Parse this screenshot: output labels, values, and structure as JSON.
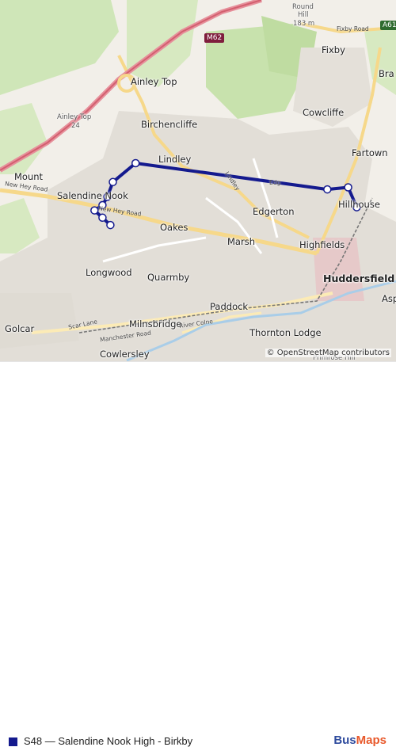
{
  "map": {
    "places": {
      "round_hill": "Round",
      "hill": "Hill",
      "hill_elev": "183 m",
      "fixby": "Fixby",
      "bra": "Bra",
      "ainley_top": "Ainley Top",
      "ainley_top_24": "Ainley Top",
      "birchencliffe": "Birchencliffe",
      "cowcliffe": "Cowcliffe",
      "fartown": "Fartown",
      "lindley": "Lindley",
      "mount": "Mount",
      "salendine_nook": "Salendine Nook",
      "hillhouse": "Hillhouse",
      "edgerton": "Edgerton",
      "oakes": "Oakes",
      "highfields": "Highfields",
      "marsh": "Marsh",
      "huddersfield": "Huddersfield",
      "longwood": "Longwood",
      "quarmby": "Quarmby",
      "asp": "Asp",
      "paddock": "Paddock",
      "golcar": "Golcar",
      "milnsbridge": "Milnsbridge",
      "thornton_lodge": "Thornton Lodge",
      "cowlersley": "Cowlersley",
      "primrose_hill": "Primrose Hill"
    },
    "roads": {
      "fixby_road": "Fixby Road",
      "new_hey_road": "New Hey Road",
      "new_hey_road_2": "New Hey Road",
      "scar_lane": "Scar Lane",
      "manchester_road": "Manchester Road",
      "river_colne": "River Colne",
      "lindley_road": "Lindley",
      "edgerton_road": "Edg"
    },
    "shields": {
      "m62": "M62",
      "a61": "A61",
      "j24": "24"
    },
    "attribution": "© OpenStreetMap contributors",
    "route": {
      "color": "#141a8e",
      "stops": [
        {
          "name": "Salendine Nook High",
          "lat": 53.6523,
          "lon": -1.8354
        },
        {
          "name": "stop-2",
          "lat": 53.6528,
          "lon": -1.8341
        },
        {
          "name": "stop-3",
          "lat": 53.6536,
          "lon": -1.8333
        },
        {
          "name": "stop-4",
          "lat": 53.655,
          "lon": -1.8324
        },
        {
          "name": "stop-5",
          "lat": 53.6568,
          "lon": -1.8287
        },
        {
          "name": "stop-6",
          "lat": 53.6543,
          "lon": -1.7974
        },
        {
          "name": "stop-7",
          "lat": 53.6545,
          "lon": -1.794
        },
        {
          "name": "Birkby",
          "lat": 53.6526,
          "lon": -1.7926
        },
        {
          "name": "stop-9",
          "lat": 53.6516,
          "lon": -1.8341
        },
        {
          "name": "stop-10",
          "lat": 53.6509,
          "lon": -1.8328
        }
      ]
    }
  },
  "legend": {
    "label": "S48 — Salendine Nook High - Birkby",
    "color": "#141a8e"
  },
  "brand": {
    "part1": "Bus",
    "part2": "Maps"
  }
}
